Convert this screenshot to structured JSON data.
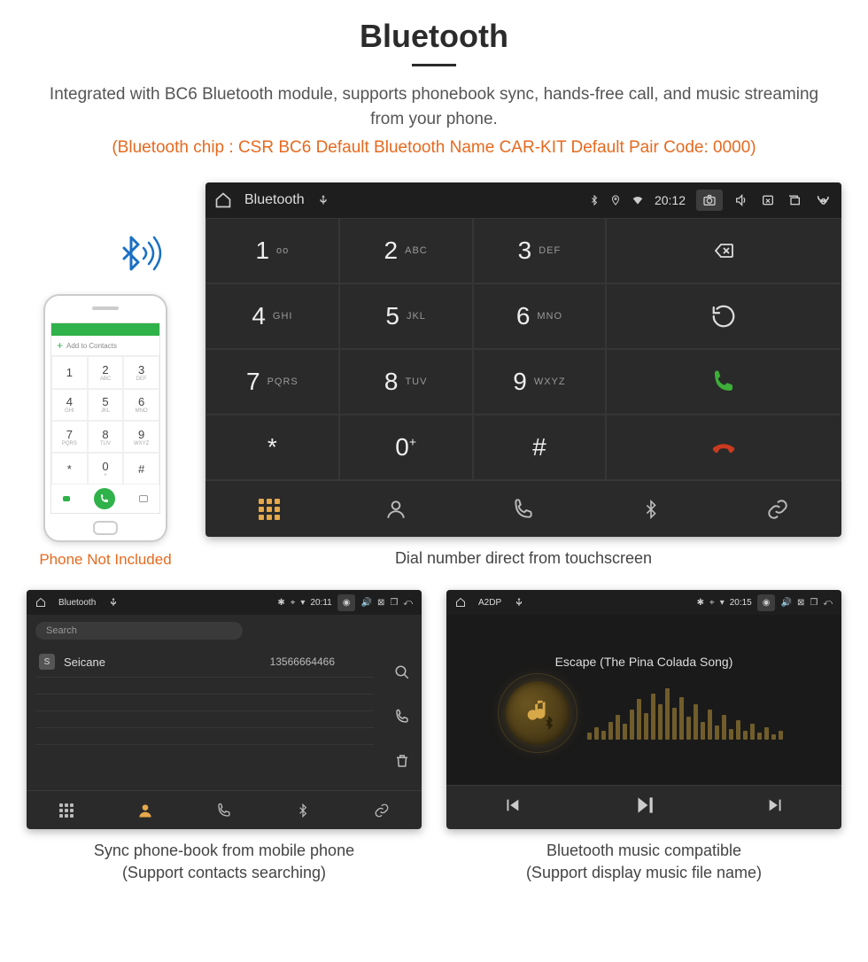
{
  "header": {
    "title": "Bluetooth",
    "description": "Integrated with BC6 Bluetooth module, supports phonebook sync, hands-free call, and music streaming from your phone.",
    "specs": "(Bluetooth chip : CSR BC6     Default Bluetooth Name CAR-KIT     Default Pair Code: 0000)"
  },
  "phone_preview": {
    "add_contacts": "Add to Contacts",
    "caption": "Phone Not Included",
    "keys": [
      {
        "n": "1",
        "s": ""
      },
      {
        "n": "2",
        "s": "ABC"
      },
      {
        "n": "3",
        "s": "DEF"
      },
      {
        "n": "4",
        "s": "GHI"
      },
      {
        "n": "5",
        "s": "JKL"
      },
      {
        "n": "6",
        "s": "MNO"
      },
      {
        "n": "7",
        "s": "PQRS"
      },
      {
        "n": "8",
        "s": "TUV"
      },
      {
        "n": "9",
        "s": "WXYZ"
      },
      {
        "n": "*",
        "s": ""
      },
      {
        "n": "0",
        "s": "+"
      },
      {
        "n": "#",
        "s": ""
      }
    ]
  },
  "dialer": {
    "topbar_title": "Bluetooth",
    "time": "20:12",
    "keys": [
      {
        "n": "1",
        "s": "ᴏᴏ"
      },
      {
        "n": "2",
        "s": "ABC"
      },
      {
        "n": "3",
        "s": "DEF"
      },
      {
        "n": "4",
        "s": "GHI"
      },
      {
        "n": "5",
        "s": "JKL"
      },
      {
        "n": "6",
        "s": "MNO"
      },
      {
        "n": "7",
        "s": "PQRS"
      },
      {
        "n": "8",
        "s": "TUV"
      },
      {
        "n": "9",
        "s": "WXYZ"
      },
      {
        "n": "*",
        "s": ""
      },
      {
        "n": "0",
        "s": "+",
        "plus": true
      },
      {
        "n": "#",
        "s": ""
      }
    ],
    "caption": "Dial number direct from touchscreen"
  },
  "phonebook": {
    "topbar_title": "Bluetooth",
    "time": "20:11",
    "search_placeholder": "Search",
    "contact_name": "Seicane",
    "contact_number": "13566664466",
    "caption_l1": "Sync phone-book from mobile phone",
    "caption_l2": "(Support contacts searching)"
  },
  "music": {
    "topbar_title": "A2DP",
    "time": "20:15",
    "track": "Escape (The Pina Colada Song)",
    "caption_l1": "Bluetooth music compatible",
    "caption_l2": "(Support display music file name)"
  },
  "colors": {
    "accent": "#e66a1f",
    "gold": "#d7a848",
    "green": "#3eae3a",
    "red": "#c93a1e"
  }
}
